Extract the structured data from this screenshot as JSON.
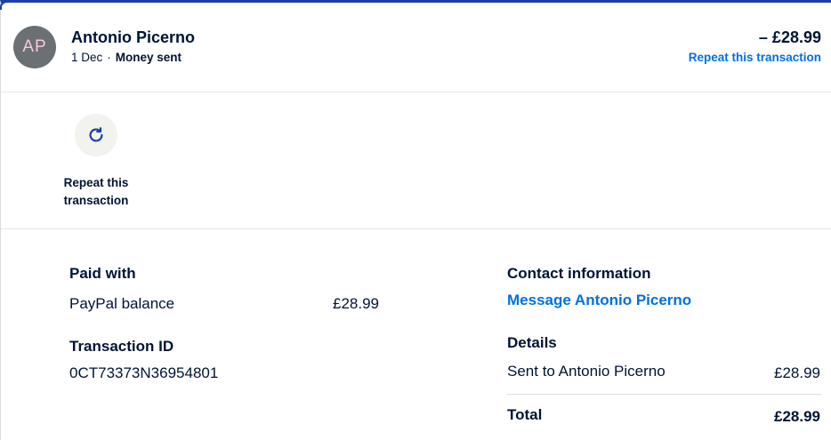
{
  "header": {
    "avatar_initials": "AP",
    "name": "Antonio Picerno",
    "date": "1 Dec",
    "separator": "·",
    "type": "Money sent",
    "amount": "– £28.99",
    "repeat_link": "Repeat this transaction"
  },
  "actions": {
    "repeat_label": "Repeat this\ntransaction",
    "repeat_icon": "refresh-icon"
  },
  "paid_with": {
    "title": "Paid with",
    "method": "PayPal balance",
    "amount": "£28.99"
  },
  "transaction": {
    "title": "Transaction ID",
    "id": "0CT73373N36954801"
  },
  "contact": {
    "title": "Contact information",
    "message_link": "Message Antonio Picerno"
  },
  "details": {
    "title": "Details",
    "sent_to_label": "Sent to Antonio Picerno",
    "sent_to_amount": "£28.99",
    "total_label": "Total",
    "total_amount": "£28.99"
  },
  "colors": {
    "accent_border": "#1d3fa8",
    "link": "#0070e0",
    "text": "#001435",
    "avatar_bg": "#6b7075",
    "avatar_text": "#f8c8d8"
  }
}
